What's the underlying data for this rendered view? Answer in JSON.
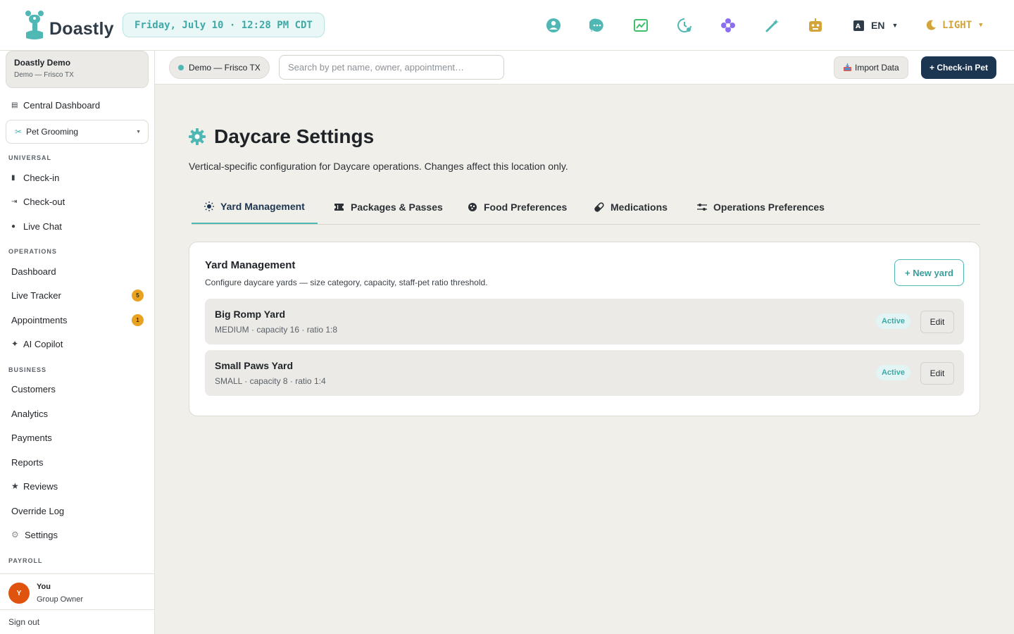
{
  "header": {
    "brand": "Doastly",
    "datetime": "Friday, July 10 · 12:28 PM CDT",
    "language": "EN",
    "theme": "LIGHT",
    "icons": [
      "team-icon",
      "chat-icon",
      "chart-icon",
      "clock-icon",
      "flower-icon",
      "magic-wand-icon",
      "robot-icon"
    ]
  },
  "sidebar": {
    "org_name": "Doastly Demo",
    "org_location": "Demo — Frisco TX",
    "central_dashboard": "Central Dashboard",
    "vertical_select": "Pet Grooming",
    "sections": {
      "universal": "UNIVERSAL",
      "operations": "OPERATIONS",
      "business": "BUSINESS",
      "payroll": "PAYROLL"
    },
    "universal_items": [
      "Check-in",
      "Check-out",
      "Live Chat"
    ],
    "operations_items": {
      "dashboard": "Dashboard",
      "live_tracker": "Live Tracker",
      "live_tracker_badge": "5",
      "appointments": "Appointments",
      "appointments_badge": "1",
      "ai_copilot": "AI Copilot"
    },
    "business_items": [
      "Customers",
      "Analytics",
      "Payments",
      "Reports",
      "Reviews",
      "Override Log",
      "Settings"
    ],
    "user": {
      "initial": "Y",
      "name": "You",
      "role": "Group Owner"
    },
    "sign_out": "Sign out"
  },
  "subbar": {
    "location": "Demo — Frisco TX",
    "search_placeholder": "Search by pet name, owner, appointment…",
    "import_label": "Import Data",
    "checkin_label": "+ Check-in Pet"
  },
  "main": {
    "title": "Daycare Settings",
    "description": "Vertical-specific configuration for Daycare operations. Changes affect this location only.",
    "tabs": [
      "Yard Management",
      "Packages & Passes",
      "Food Preferences",
      "Medications",
      "Operations Preferences"
    ],
    "active_tab": "Yard Management",
    "card": {
      "title": "Yard Management",
      "subtitle": "Configure daycare yards — size category, capacity, staff-pet ratio threshold.",
      "new_button": "+ New yard",
      "yards": [
        {
          "name": "Big Romp Yard",
          "meta": "MEDIUM · capacity 16 · ratio 1:8",
          "status": "Active",
          "edit": "Edit"
        },
        {
          "name": "Small Paws Yard",
          "meta": "SMALL · capacity 8 · ratio 1:4",
          "status": "Active",
          "edit": "Edit"
        }
      ]
    }
  },
  "colors": {
    "accent_teal": "#4fb7b4",
    "primary_navy": "#1c3550",
    "badge_amber": "#e9a21f",
    "avatar_orange": "#e0530e",
    "theme_gold": "#d3a43a"
  }
}
